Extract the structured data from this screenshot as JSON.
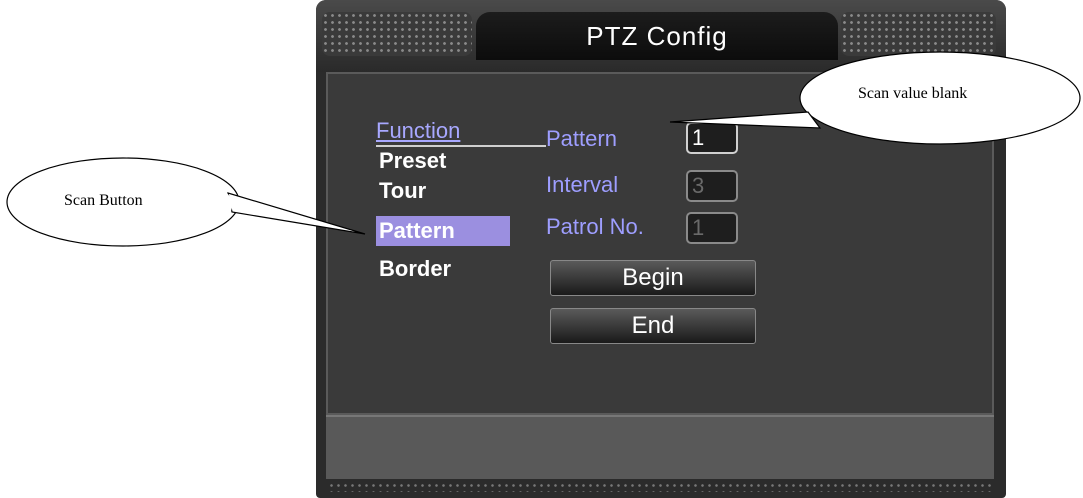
{
  "window": {
    "title": "PTZ Config"
  },
  "menu": {
    "header": "Function",
    "items": [
      {
        "label": "Preset",
        "selected": false
      },
      {
        "label": "Tour",
        "selected": false
      },
      {
        "label": "Pattern",
        "selected": true
      },
      {
        "label": "Border",
        "selected": false
      }
    ]
  },
  "fields": [
    {
      "label": "Pattern",
      "value": "1",
      "enabled": true
    },
    {
      "label": "Interval",
      "value": "3",
      "enabled": false
    },
    {
      "label": "Patrol No.",
      "value": "1",
      "enabled": false
    }
  ],
  "buttons": {
    "begin": "Begin",
    "end": "End"
  },
  "callouts": {
    "scan_button": "Scan Button",
    "scan_value": "Scan value blank"
  }
}
